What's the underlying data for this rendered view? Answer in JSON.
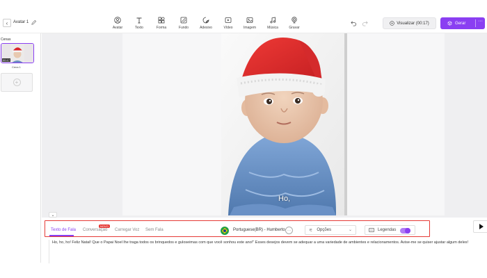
{
  "header": {
    "project_title": "Avatar 1",
    "tools": [
      {
        "label": "Avatar",
        "icon": "avatar-icon"
      },
      {
        "label": "Texto",
        "icon": "text-icon"
      },
      {
        "label": "Forma",
        "icon": "shape-icon"
      },
      {
        "label": "Fundo",
        "icon": "background-icon"
      },
      {
        "label": "Adesivo",
        "icon": "sticker-icon"
      },
      {
        "label": "Vídeo",
        "icon": "video-icon"
      },
      {
        "label": "Imagem",
        "icon": "image-icon"
      },
      {
        "label": "Música",
        "icon": "music-icon"
      },
      {
        "label": "Gravar",
        "icon": "record-icon"
      }
    ],
    "preview_label": "Visualizar (00:17)",
    "generate_label": "Gerar",
    "generate_more": "···"
  },
  "scenes": {
    "title": "Cenas",
    "items": [
      {
        "name": "Cena 1",
        "duration": "00:17"
      }
    ]
  },
  "canvas": {
    "caption": "Ho,"
  },
  "bottom": {
    "tabs": [
      {
        "label": "Texto de Fala",
        "active": true
      },
      {
        "label": "Conversação",
        "badge": "NOVO"
      },
      {
        "label": "Carregar Voz"
      },
      {
        "label": "Sem Fala"
      }
    ],
    "voice": "Portuguese(BR) - Humberto",
    "voice_more": "···",
    "options_label": "Opções",
    "subtitles_label": "Legendas",
    "subtitles_on": true,
    "script": "Ho, ho, ho! Feliz Natal! Que o Papai Noel lhe traga todos os brinquedos e guloseimas com que você sonhou este ano!\" Esses desejos devem se adequar a uma variedade de ambientes e relacionamentos. Avise-me se quiser ajustar algum deles!"
  },
  "colors": {
    "accent": "#8a3ff2",
    "highlight_box": "#e53935",
    "badge": "#e53935"
  }
}
